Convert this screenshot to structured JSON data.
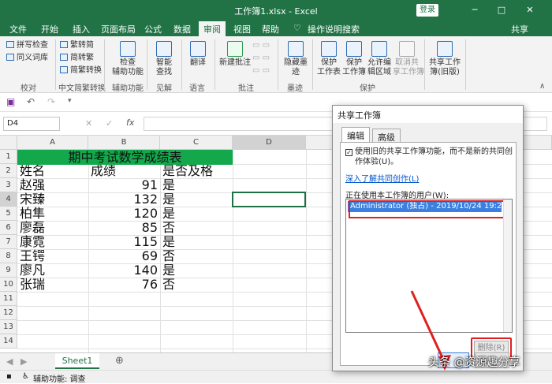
{
  "title_bar": {
    "title": "工作簿1.xlsx - Excel",
    "login": "登录",
    "minimize": "─",
    "maximize": "□",
    "close": "✕"
  },
  "tabs": {
    "file": "文件",
    "home": "开始",
    "insert": "插入",
    "layout": "页面布局",
    "formulas": "公式",
    "data": "数据",
    "review": "审阅",
    "view": "视图",
    "help": "帮助",
    "tell_me": "操作说明搜索",
    "share": "共享"
  },
  "ribbon": {
    "spell": "拼写检查",
    "thesaurus": "同义词库",
    "proofing": "校对",
    "to_trad": "繁转简",
    "to_simp": "简转繁",
    "conv": "简繁转换",
    "cn_conv": "中文简繁转换",
    "check_line1": "检查",
    "check_line2": "辅助功能",
    "accessibility": "辅助功能",
    "smart_line1": "智能",
    "smart_line2": "查找",
    "insights": "见解",
    "translate": "翻译",
    "language": "语言",
    "new_comment": "新建批注",
    "comments": "批注",
    "hide_line1": "隐藏墨",
    "hide_line2": "迹",
    "ink": "墨迹",
    "protect_sheet1": "保护",
    "protect_sheet2": "工作表",
    "protect_wb1": "保护",
    "protect_wb2": "工作簿",
    "allow_edit1": "允许编",
    "allow_edit2": "辑区域",
    "unshare1": "取消共",
    "unshare2": "享工作簿",
    "protect": "保护",
    "share_wb1": "共享工作",
    "share_wb2": "簿(旧版)"
  },
  "name_box": "D4",
  "formula_icons": {
    "cancel": "✕",
    "enter": "✓",
    "fx": "fx"
  },
  "columns": [
    "A",
    "B",
    "C",
    "D"
  ],
  "rows": [
    "1",
    "2",
    "3",
    "4",
    "5",
    "6",
    "7",
    "8",
    "9",
    "10",
    "11",
    "12",
    "13",
    "14"
  ],
  "sheet": {
    "title": "期中考试数学成绩表",
    "headers": [
      "姓名",
      "成绩",
      "是否及格"
    ],
    "data": [
      [
        "赵强",
        "91",
        "是"
      ],
      [
        "宋臻",
        "132",
        "是"
      ],
      [
        "柏隼",
        "120",
        "是"
      ],
      [
        "廖磊",
        "85",
        "否"
      ],
      [
        "康霓",
        "115",
        "是"
      ],
      [
        "王锷",
        "69",
        "否"
      ],
      [
        "廖凡",
        "140",
        "是"
      ],
      [
        "张瑞",
        "76",
        "否"
      ]
    ]
  },
  "sheet_tab": "Sheet1",
  "add_sheet": "⊕",
  "status": {
    "text": "辅助功能: 调查"
  },
  "dialog": {
    "title": "共享工作簿",
    "tab_edit": "编辑",
    "tab_advanced": "高级",
    "checkbox_text": "使用旧的共享工作簿功能，而不是新的共同创作体验(U)。",
    "checkbox_checked": "✓",
    "link": "深入了解共同创作(L)",
    "users_label": "正在使用本工作簿的用户(W):",
    "user": "Administrator (独占) - 2019/10/24 19:20",
    "delete": "删除(R)"
  },
  "watermark": "头条 @资源趣分享",
  "colors": {
    "excel_green": "#217346",
    "header_fill": "#13a84c",
    "highlight_red": "#e02020",
    "selection_blue": "#3b7fe0"
  }
}
